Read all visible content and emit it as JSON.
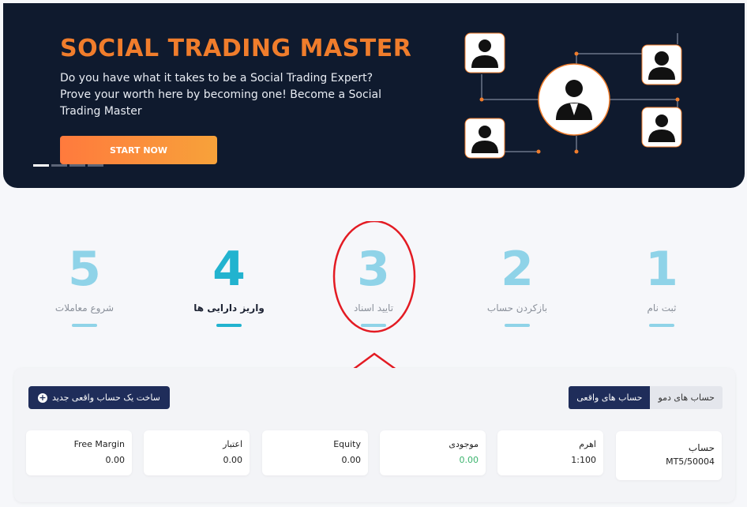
{
  "banner": {
    "title": "SOCIAL TRADING MASTER",
    "description": "Do you have what it takes to be a Social Trading Expert? Prove your worth here by becoming one! Become a Social Trading Master",
    "cta": "START NOW",
    "slides_count": 4,
    "active_slide": 1
  },
  "steps": [
    {
      "number": "1",
      "label": "ثبت نام"
    },
    {
      "number": "2",
      "label": "بازکردن حساب"
    },
    {
      "number": "3",
      "label": "تایید اسناد"
    },
    {
      "number": "4",
      "label": "واریز دارایی ها"
    },
    {
      "number": "5",
      "label": "شروع معاملات"
    }
  ],
  "accounts": {
    "tab_demo": "حساب های دمو",
    "tab_real": "حساب های واقعی",
    "create_button": "ساخت یک حساب واقعی جدید",
    "account_label": "حساب",
    "account_value": "MT5/50004",
    "leverage_label": "اهرم",
    "leverage_value": "1:100",
    "balance_label": "موجودی",
    "balance_value": "0.00",
    "equity_label": "Equity",
    "equity_value": "0.00",
    "credit_label": "اعتبار",
    "credit_value": "0.00",
    "free_margin_label": "Free Margin",
    "free_margin_value": "0.00"
  },
  "colors": {
    "banner_bg": "#0f1a2e",
    "brand_orange": "#f07d2c",
    "step_active": "#22b3cf",
    "step_inactive": "#8fd3e8",
    "navy": "#1f2d5a",
    "positive": "#3cb46e",
    "annotation": "#e31b23"
  }
}
